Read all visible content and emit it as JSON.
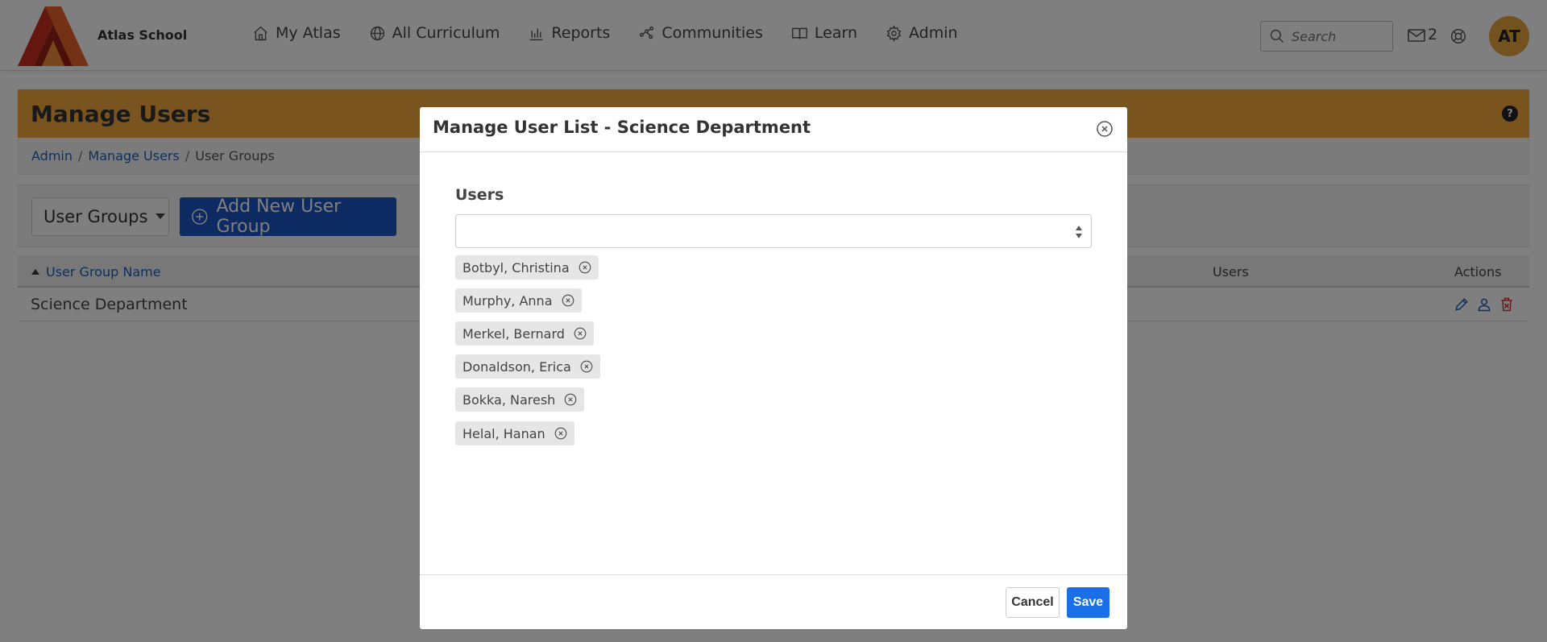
{
  "app": {
    "school_name": "Atlas School"
  },
  "nav": {
    "items": [
      {
        "label": "My Atlas",
        "icon": "home-icon"
      },
      {
        "label": "All Curriculum",
        "icon": "globe-icon"
      },
      {
        "label": "Reports",
        "icon": "bar-chart-icon"
      },
      {
        "label": "Communities",
        "icon": "network-icon"
      },
      {
        "label": "Learn",
        "icon": "book-icon"
      },
      {
        "label": "Admin",
        "icon": "gear-icon"
      }
    ],
    "search_placeholder": "Search",
    "mail_count": "2",
    "avatar_initials": "AT"
  },
  "page": {
    "title": "Manage Users",
    "help_glyph": "?",
    "breadcrumb": {
      "admin": "Admin",
      "manage_users": "Manage Users",
      "current": "User Groups",
      "separator": "/"
    }
  },
  "toolbar": {
    "dropdown_label": "User Groups",
    "add_button_label": "Add New User Group"
  },
  "table": {
    "columns": {
      "name": "User Group Name",
      "users": "Users",
      "actions": "Actions"
    },
    "rows": [
      {
        "name": "Science Department"
      }
    ]
  },
  "modal": {
    "title": "Manage User List - Science Department",
    "users_label": "Users",
    "selected_users": [
      "Botbyl, Christina",
      "Murphy, Anna",
      "Merkel, Bernard",
      "Donaldson, Erica",
      "Bokka, Naresh",
      "Helal, Hanan"
    ],
    "cancel_label": "Cancel",
    "save_label": "Save"
  },
  "colors": {
    "header_accent": "#f5a93d",
    "primary_button": "#1a56c4",
    "save_button": "#1a6ee6",
    "link": "#1f5fbf",
    "avatar_bg": "#e7a43f",
    "delete_icon": "#d9302f"
  }
}
